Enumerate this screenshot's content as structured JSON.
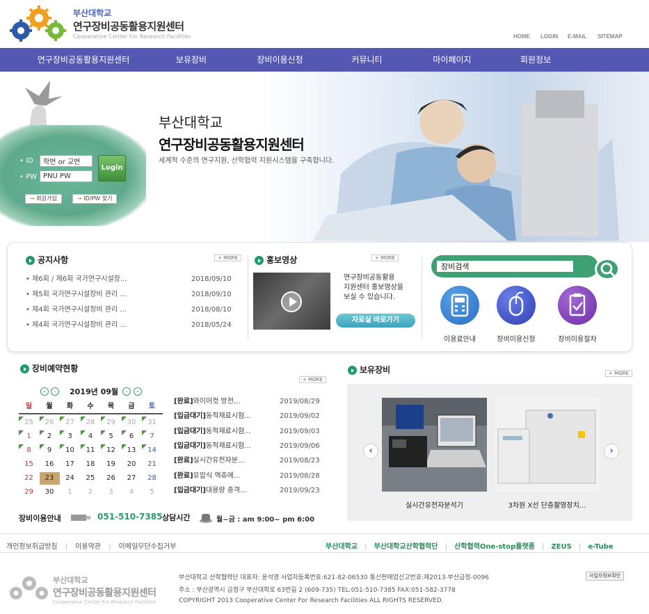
{
  "header": {
    "logo_small": "부산대학교",
    "logo_big": "연구장비공동활용지원센터",
    "logo_en": "Cooperative Center For Research Facilities",
    "util_links": [
      "HOME",
      "LOGIN",
      "E-MAIL",
      "SITEMAP"
    ]
  },
  "gnb": [
    "연구장비공동활용지원센터",
    "보유장비",
    "장비이용신청",
    "커뮤니티",
    "마이페이지",
    "회원정보"
  ],
  "hero": {
    "title1": "부산대학교",
    "title2": "연구장비공동활용지원센터",
    "subtitle": "세계적 수준의 연구지원, 산학협력 지원시스템을 구축합니다."
  },
  "login": {
    "id_label": "ID",
    "pw_label": "PW",
    "id_value": "학번 or 교번",
    "pw_value": "PNU PW",
    "login_button": "Login",
    "join_button": "회원가입",
    "find_button": "ID/PW 찾기"
  },
  "notice": {
    "title": "공지사항",
    "more": "+ MORE",
    "items": [
      {
        "text": "제6회 / 제6회 국가연구시설장...",
        "date": "2018/09/10"
      },
      {
        "text": "제5회 국가연구시설장비 관리 ...",
        "date": "2018/09/10"
      },
      {
        "text": "제4회 국가연구시설장비 관리 ...",
        "date": "2018/08/10"
      },
      {
        "text": "제4회 국가연구시설장비 관리 ...",
        "date": "2018/05/24"
      }
    ]
  },
  "promo": {
    "title": "홍보영상",
    "more": "+ MORE",
    "desc": [
      "연구장비공동활용",
      "지원센터 홍보영상을",
      "보실 수 있습니다."
    ],
    "button": "자료실 바로가기"
  },
  "search": {
    "value": "장비검색"
  },
  "quick_icons": [
    {
      "label": "이용료안내",
      "icon": "calculator-icon",
      "color": "#2f7ad0"
    },
    {
      "label": "장비이용신청",
      "icon": "mouse-icon",
      "color": "#3a4fc1"
    },
    {
      "label": "장비이용절차",
      "icon": "checklist-icon",
      "color": "#7b3db0"
    }
  ],
  "reservation": {
    "title": "장비예약현황",
    "more": "+ MORE",
    "month": "2019년 09월",
    "weekdays": [
      "일",
      "월",
      "화",
      "수",
      "목",
      "금",
      "토"
    ],
    "weeks": [
      [
        "25",
        "26",
        "27",
        "28",
        "29",
        "30",
        "31"
      ],
      [
        "1",
        "2",
        "3",
        "4",
        "5",
        "6",
        "7"
      ],
      [
        "8",
        "9",
        "10",
        "11",
        "12",
        "13",
        "14"
      ],
      [
        "15",
        "16",
        "17",
        "18",
        "19",
        "20",
        "21"
      ],
      [
        "22",
        "23",
        "24",
        "25",
        "26",
        "27",
        "28"
      ],
      [
        "29",
        "30",
        "1",
        "2",
        "3",
        "4",
        "5"
      ]
    ],
    "items": [
      {
        "status": "[완료]",
        "text": "와이어컷 방전...",
        "date": "2019/08/29"
      },
      {
        "status": "[입금대기]",
        "text": "동적재료시험...",
        "date": "2019/09/02"
      },
      {
        "status": "[입금대기]",
        "text": "동적재료시험...",
        "date": "2019/09/03"
      },
      {
        "status": "[입금대기]",
        "text": "동적재료시험...",
        "date": "2019/09/06"
      },
      {
        "status": "[완료]",
        "text": "실시간유전자분...",
        "date": "2019/08/23"
      },
      {
        "status": "[완료]",
        "text": "유압식 액츄에...",
        "date": "2019/08/28"
      },
      {
        "status": "[입금대기]",
        "text": "대용량 충격...",
        "date": "2019/09/23"
      }
    ]
  },
  "equipment": {
    "title": "보유장비",
    "more": "+ MORE",
    "items": [
      {
        "label": "실시간유전자분석기"
      },
      {
        "label": "3차원 X선 단층촬영장치..."
      }
    ]
  },
  "contact": {
    "guide_label": "장비이용안내",
    "phone": "051-510-7385",
    "hours_label": "상담시간",
    "hours": "월~금 : am 9:00~ pm 6:00"
  },
  "footer": {
    "left_links": [
      "개인정보취급방침",
      "이용약관",
      "이메일무단수집거부"
    ],
    "right_links": [
      "부산대학교",
      "부산대학교산학협력단",
      "산학협력One-stop플랫폼",
      "ZEUS",
      "e-Tube"
    ],
    "info1": "부산대학교 산학협력단 대표자: 윤석영  사업자등록번호:621-82-06530  통신판매업신고번호:제2013-부산금정-0096",
    "biz_button": "사업자정보확인",
    "info2": "주소 : 부산광역시 금정구 부산대학로 63번길 2 (609-735)  TEL:051-510-7385   FAX:051-582-3778",
    "info3": "COPYRIGHT 2013 Cooperative Center For Research Facilities ALL RIGHTS RESERVED.",
    "logo_small": "부산대학교",
    "logo_big": "연구장비공동활용지원센터",
    "logo_en": "Cooperative Center For Research Facilities"
  }
}
